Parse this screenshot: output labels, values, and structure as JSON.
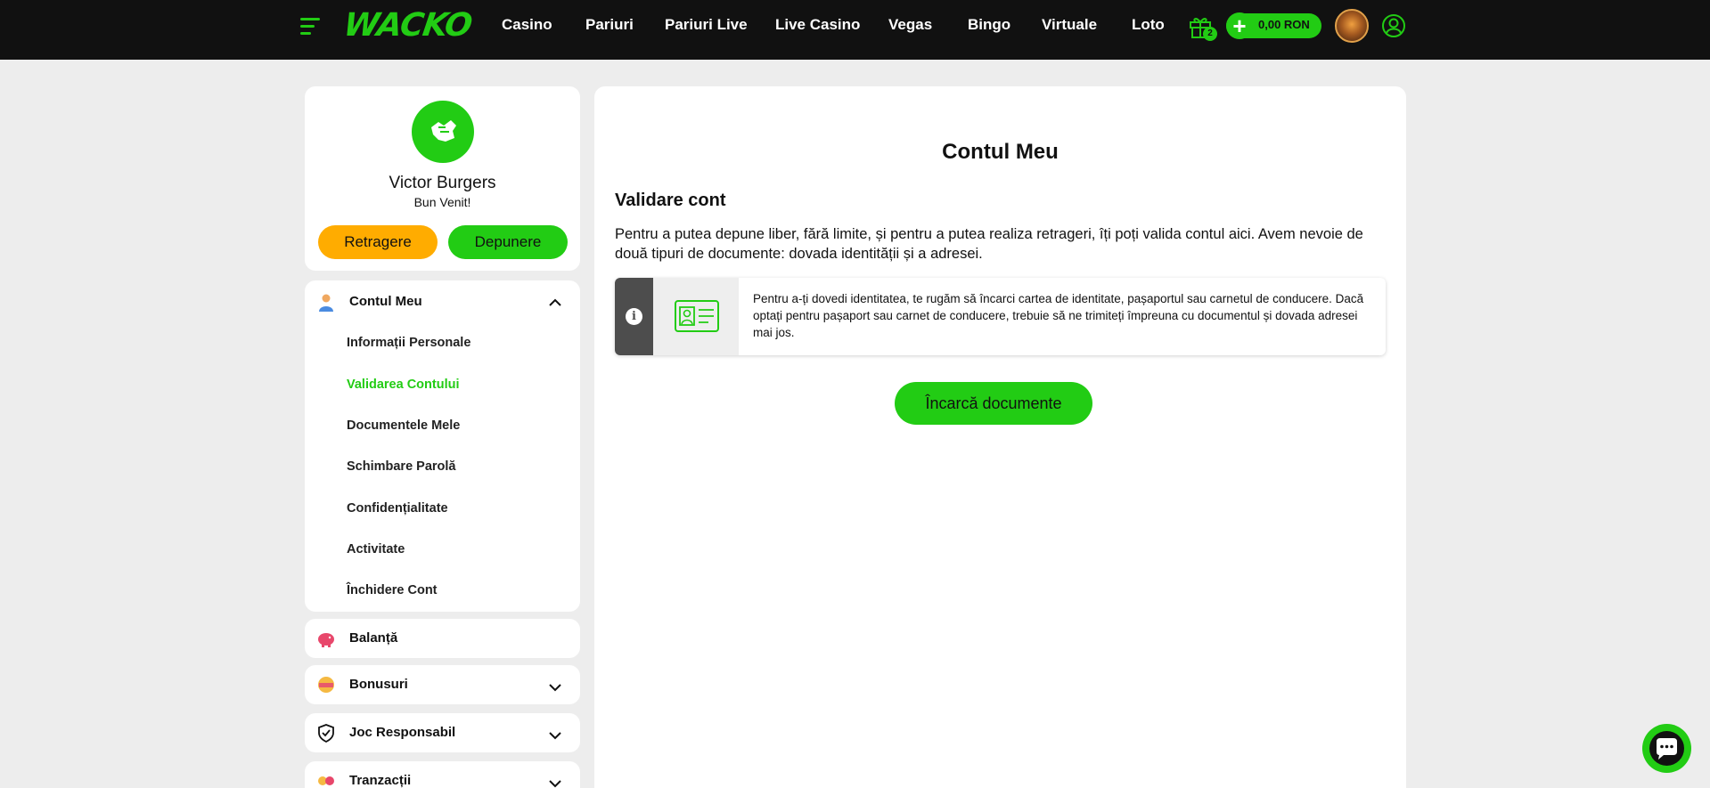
{
  "brand": {
    "logo": "WACKO",
    "accent": "#22cc14",
    "warning": "#ffac00",
    "topbar_bg": "#111111"
  },
  "nav": {
    "items": [
      "Casino",
      "Pariuri",
      "Pariuri Live",
      "Live Casino",
      "Vegas",
      "Bingo",
      "Virtuale",
      "Loto"
    ]
  },
  "header": {
    "gift_count": "2",
    "balance": "0,00 RON",
    "icons": [
      "menu-icon",
      "gift-icon",
      "plus-icon",
      "user-circle-icon"
    ]
  },
  "profile": {
    "name": "Victor Burgers",
    "greeting": "Bun Venit!",
    "withdraw_label": "Retragere",
    "deposit_label": "Depunere"
  },
  "menu": {
    "title": "Contul Meu",
    "items": [
      "Informații Personale",
      "Validarea Contului",
      "Documentele Mele",
      "Schimbare Parolă",
      "Confidențialitate",
      "Activitate",
      "Închidere Cont"
    ],
    "active_index": 1
  },
  "accordions": [
    {
      "label": "Balanță",
      "icon": "piggy-bank-icon"
    },
    {
      "label": "Bonusuri",
      "icon": "bonus-icon"
    },
    {
      "label": "Joc Responsabil",
      "icon": "shield-check-icon"
    },
    {
      "label": "Tranzacții",
      "icon": "transactions-icon"
    }
  ],
  "main": {
    "title": "Contul Meu",
    "section_title": "Validare cont",
    "intro": "Pentru a putea depune liber, fără limite, și pentru a putea realiza retrageri, îți poți valida contul aici. Avem nevoie de două tipuri de documente: dovada identității și a adresei.",
    "info_text": "Pentru a-ți dovedi identitatea, te rugăm să încarci cartea de identitate, pașaportul sau carnetul de conducere. Dacă optați pentru pașaport sau carnet de conducere, trebuie să ne trimiteți împreuna cu documentul și dovada adresei mai jos.",
    "upload_label": "Încarcă documente"
  }
}
